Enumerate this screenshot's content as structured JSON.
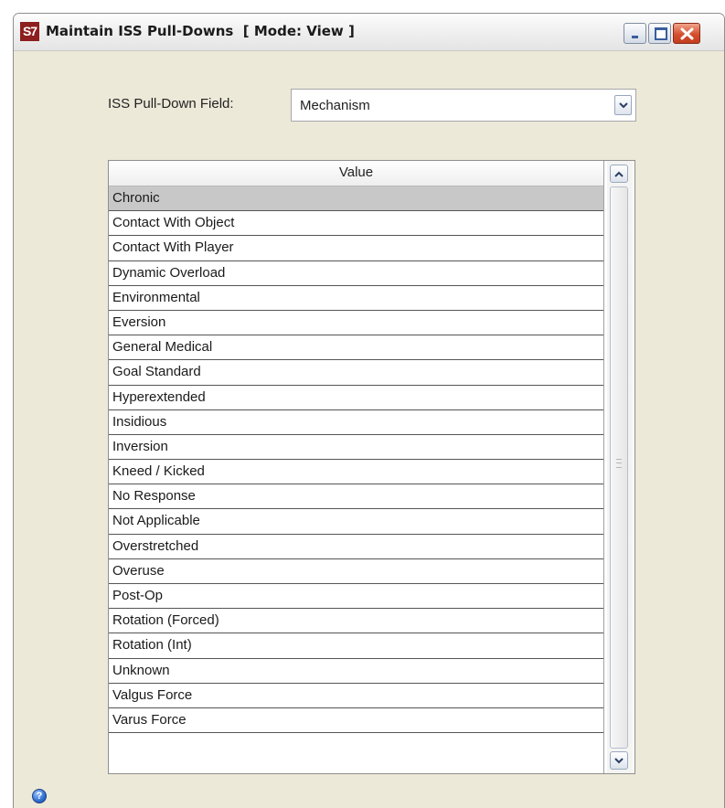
{
  "window": {
    "logo_text": "S7",
    "title": "Maintain ISS Pull-Downs  [ Mode: View ]"
  },
  "form": {
    "field_label": "ISS Pull-Down Field:",
    "field_value": "Mechanism"
  },
  "table": {
    "column_header": "Value",
    "selected_row": "Chronic",
    "rows": [
      "Chronic",
      "Contact With Object",
      "Contact With Player",
      "Dynamic Overload",
      "Environmental",
      "Eversion",
      "General Medical",
      "Goal Standard",
      "Hyperextended",
      "Insidious",
      "Inversion",
      "Kneed / Kicked",
      "No Response",
      "Not Applicable",
      "Overstretched",
      "Overuse",
      "Post-Op",
      "Rotation (Forced)",
      "Rotation (Int)",
      "Unknown",
      "Valgus Force",
      "Varus Force"
    ]
  },
  "footer": {
    "help_icon": "help-icon",
    "help_glyph": "?"
  }
}
